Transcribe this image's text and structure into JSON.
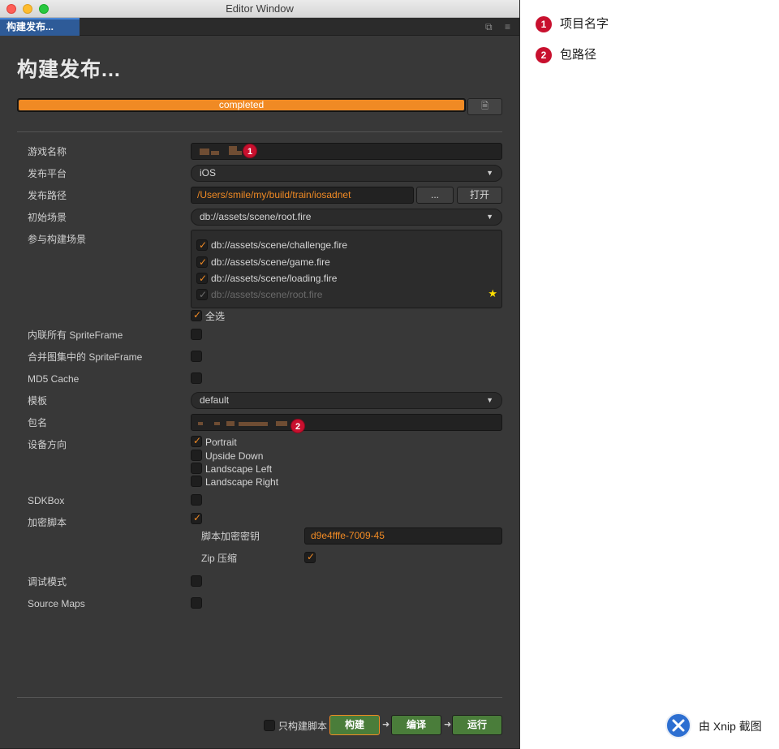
{
  "window": {
    "title": "Editor Window",
    "tab_label": "构建发布...",
    "tab_icons": [
      "restore-icon",
      "menu-icon"
    ]
  },
  "page": {
    "title": "构建发布...",
    "progress": {
      "text": "completed",
      "percent": 100,
      "color": "#f08a24"
    }
  },
  "form": {
    "game_name": {
      "label": "游戏名称"
    },
    "platform": {
      "label": "发布平台",
      "value": "iOS"
    },
    "build_path": {
      "label": "发布路径",
      "value": "/Users/smile/my/build/train/iosadnet",
      "browse_label": "...",
      "open_label": "打开"
    },
    "start_scene": {
      "label": "初始场景",
      "value": "db://assets/scene/root.fire"
    },
    "scenes": {
      "label": "参与构建场景",
      "items": [
        {
          "label": "db://assets/scene/challenge.fire",
          "checked": true
        },
        {
          "label": "db://assets/scene/game.fire",
          "checked": true
        },
        {
          "label": "db://assets/scene/loading.fire",
          "checked": true
        },
        {
          "label": "db://assets/scene/root.fire",
          "checked": true,
          "disabled": true
        }
      ],
      "select_all_label": "全选"
    },
    "inline_spriteframe": {
      "label": "内联所有 SpriteFrame",
      "checked": false
    },
    "merge_spriteframe": {
      "label": "合并图集中的 SpriteFrame",
      "checked": false
    },
    "md5_cache": {
      "label": "MD5 Cache",
      "checked": false
    },
    "template": {
      "label": "模板",
      "value": "default"
    },
    "package_name": {
      "label": "包名"
    },
    "orientation": {
      "label": "设备方向",
      "options": [
        {
          "label": "Portrait",
          "checked": true
        },
        {
          "label": "Upside Down",
          "checked": false
        },
        {
          "label": "Landscape Left",
          "checked": false
        },
        {
          "label": "Landscape Right",
          "checked": false
        }
      ]
    },
    "sdkbox": {
      "label": "SDKBox",
      "checked": false
    },
    "encrypt_js": {
      "label": "加密脚本",
      "checked": true
    },
    "encrypt_key": {
      "label": "脚本加密密钥",
      "value": "d9e4fffe-7009-45"
    },
    "zip_compress": {
      "label": "Zip 压缩",
      "checked": true
    },
    "debug_mode": {
      "label": "调试模式",
      "checked": false
    },
    "source_maps": {
      "label": "Source Maps",
      "checked": false
    }
  },
  "footer": {
    "only_script_label": "只构建脚本",
    "build_label": "构建",
    "compile_label": "编译",
    "run_label": "运行"
  },
  "annotations": [
    {
      "number": "1",
      "text": "项目名字"
    },
    {
      "number": "2",
      "text": "包路径"
    }
  ],
  "watermark": {
    "text": "由 Xnip 截图"
  }
}
